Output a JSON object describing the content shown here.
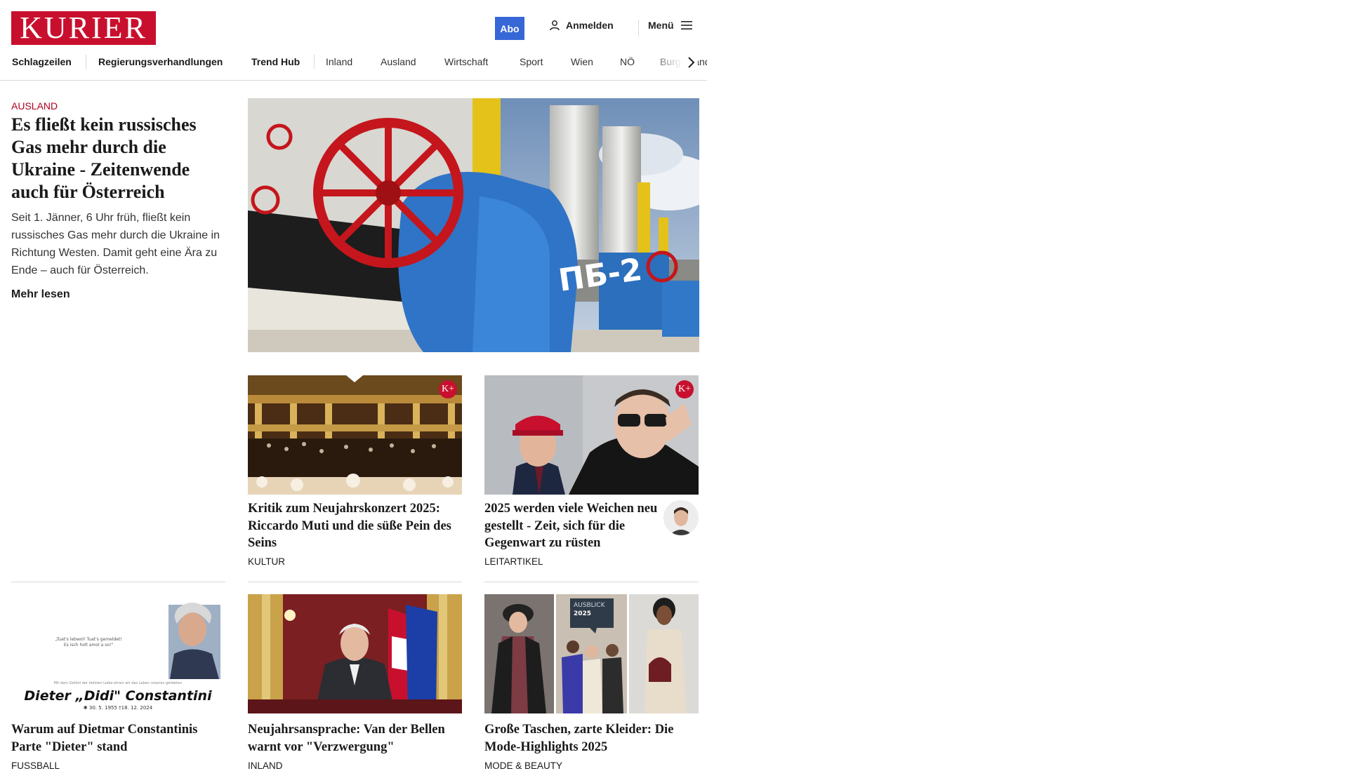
{
  "header": {
    "logo_text": "KURIER",
    "abo_label": "Abo",
    "login_label": "Anmelden",
    "menu_label": "Menü",
    "colors": {
      "brand": "#c8102e",
      "abo": "#3767d6",
      "kicker": "#b00020"
    }
  },
  "nav": {
    "items": [
      "Schlagzeilen",
      "Regierungsverhandlungen",
      "Trend Hub",
      "Inland",
      "Ausland",
      "Wirtschaft",
      "Sport",
      "Wien",
      "NÖ",
      "Burgenland"
    ]
  },
  "lead": {
    "kicker": "Ausland",
    "title": "Es fließt kein russisches Gas mehr durch die Ukraine - Zeitenwende auch für Österreich",
    "teaser": "Seit 1. Jänner, 6 Uhr früh, fließt kein russisches Gas mehr durch die Ukraine in Richtung Westen. Damit geht eine Ära zu Ende – auch für Österreich.",
    "more_label": "Mehr lesen",
    "image_text": "ПБ-2"
  },
  "cards": [
    {
      "title": "Kritik zum Neujahrskonzert 2025: Riccardo Muti und die süße Pein des Seins",
      "kicker": "KULTUR",
      "premium_badge": "K+"
    },
    {
      "title": "2025 werden viele Weichen neu gestellt - Zeit, sich für die Gegenwart zu rüsten",
      "kicker": "LEITARTIKEL",
      "premium_badge": "K+"
    },
    {
      "title": "Warum auf Dietmar Constantinis Parte \"Dieter\" stand",
      "kicker": "FUSSBALL",
      "image_name": "Dieter „Didi\" Constantini",
      "image_dates": "✱ 30. 5. 1955   †18. 12. 2024"
    },
    {
      "title": "Neujahrsansprache: Van der Bellen warnt vor \"Verzwergung\"",
      "kicker": "INLAND"
    },
    {
      "title": "Große Taschen, zarte Kleider: Die Mode-Highlights 2025",
      "kicker": "MODE & BEAUTY",
      "image_badge_1": "AUSBLICK",
      "image_badge_2": "2025"
    }
  ]
}
